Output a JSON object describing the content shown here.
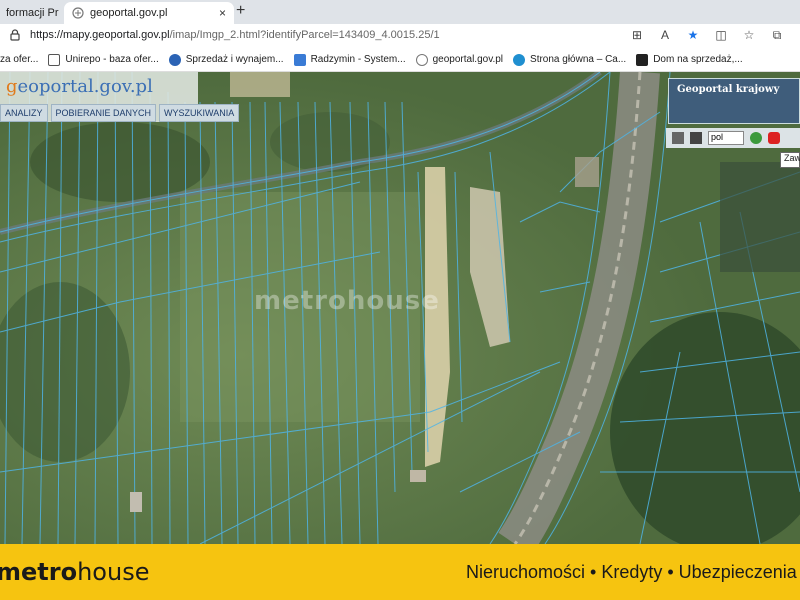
{
  "browser": {
    "tabs": [
      {
        "title": "formacji Pr",
        "active": false
      },
      {
        "title": "geoportal.gov.pl",
        "active": true
      }
    ],
    "new_tab": "+",
    "tab_close": "×",
    "address": {
      "domain": "https://mapy.geoportal.gov.pl",
      "path": "/imap/Imgp_2.html?identifyParcel=143409_4.0015.25/1"
    },
    "bookmarks": [
      {
        "label": "za ofer...",
        "icon": "folder-icon",
        "color": "#8a8a8a"
      },
      {
        "label": "Unirepo - baza ofer...",
        "icon": "home-icon",
        "color": "#555555"
      },
      {
        "label": "Sprzedaż i wynajem...",
        "icon": "globe-icon",
        "color": "#2b63b5"
      },
      {
        "label": "Radzymin - System...",
        "icon": "doc-icon",
        "color": "#3a7bd5"
      },
      {
        "label": "geoportal.gov.pl",
        "icon": "geoportal-icon",
        "color": "#777777"
      },
      {
        "label": "Strona główna – Ca...",
        "icon": "edge-icon",
        "color": "#1f8fd0"
      },
      {
        "label": "Dom na sprzedaż,...",
        "icon": "c-icon",
        "color": "#222222"
      }
    ]
  },
  "geoportal": {
    "brand_g": "g",
    "brand_rest": "eoportal.gov.pl",
    "links": [
      "ANALIZY",
      "POBIERANIE DANYCH",
      "WYSZUKIWANIA"
    ],
    "minimap_title": "Geoportal krajowy",
    "language": "pol",
    "zaw_label": "Zaw"
  },
  "watermark": "metrohouse",
  "banner": {
    "logo_bold": "metro",
    "logo_rest": "house",
    "tagline": "Nieruchomości • Kredyty • Ubezpieczenia",
    "color": "#f6c410"
  }
}
